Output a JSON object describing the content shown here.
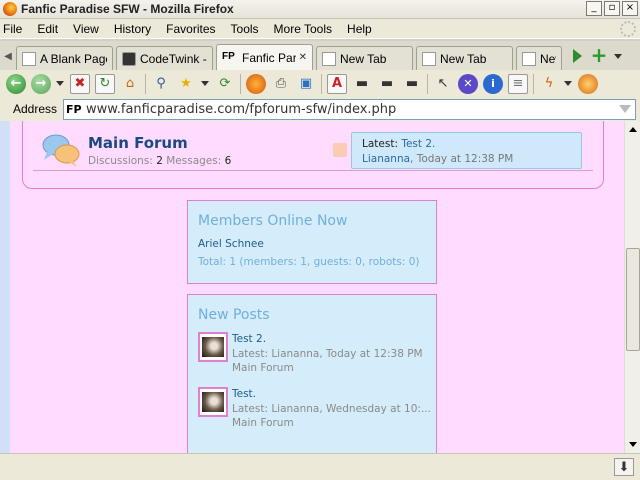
{
  "window": {
    "title": "Fanfic Paradise SFW - Mozilla Firefox",
    "buttons": {
      "minimize": "_",
      "maximize": "▫",
      "close": "×"
    }
  },
  "menu": [
    "File",
    "Edit",
    "View",
    "History",
    "Favorites",
    "Tools",
    "More Tools",
    "Help"
  ],
  "tabs": [
    {
      "label": "A Blank Page",
      "icon": "puzzle-icon"
    },
    {
      "label": "CodeTwink -...",
      "icon": "webcam-icon"
    },
    {
      "label": "Fanfic Par...",
      "icon": "fp-favicon",
      "favicon_text": "FP",
      "active": true
    },
    {
      "label": "New Tab",
      "icon": "page-icon"
    },
    {
      "label": "New Tab",
      "icon": "page-icon"
    },
    {
      "label": "New",
      "icon": "page-icon"
    }
  ],
  "address": {
    "label": "Address",
    "favicon_text": "FP",
    "url": "www.fanficparadise.com/fpforum-sfw/index.php"
  },
  "forum": {
    "title": "Main Forum",
    "discussions_label": "Discussions:",
    "discussions": "2",
    "messages_label": "Messages:",
    "messages": "6",
    "latest_label": "Latest:",
    "latest_title": "Test 2.",
    "latest_user": "Liananna",
    "latest_time": "Today at 12:38 PM"
  },
  "members_online": {
    "title": "Members Online Now",
    "member": "Ariel Schnee",
    "total": "Total: 1 (members: 1, guests: 0, robots: 0)"
  },
  "new_posts": {
    "title": "New Posts",
    "posts": [
      {
        "title": "Test 2.",
        "latest": "Latest: Liananna, Today at 12:38 PM",
        "forum": "Main Forum"
      },
      {
        "title": "Test.",
        "latest": "Latest: Liananna, Wednesday at 10:...",
        "forum": "Main Forum"
      }
    ]
  },
  "colors": {
    "page_bg": "#ffdcff",
    "panel_bg": "#d5ecfb",
    "panel_border": "#e07fd0",
    "link": "#1d5c8c",
    "heading": "#6fb0d8"
  }
}
